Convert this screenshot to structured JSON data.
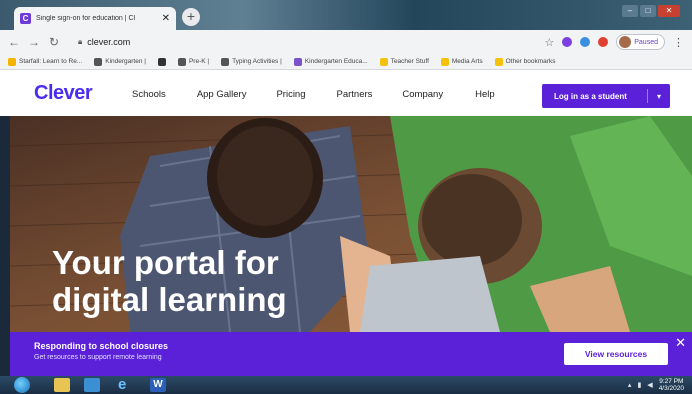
{
  "browser": {
    "tab_title": "Single sign-on for education | Cl",
    "tab_close": "✕",
    "new_tab": "+",
    "url": "clever.com",
    "profile_label": "Paused",
    "bookmarks": [
      {
        "label": "Starfall: Learn to Re...",
        "color": "#f4b400"
      },
      {
        "label": "Kindergarten |",
        "color": "#555555"
      },
      {
        "label": "",
        "color": "#333333"
      },
      {
        "label": "Pre-K |",
        "color": "#555555"
      },
      {
        "label": "Typing Activities |",
        "color": "#555555"
      },
      {
        "label": "Kindergarten Educa...",
        "color": "#7b52c9"
      },
      {
        "label": "Teacher Stuff",
        "color": "#f4c20d"
      },
      {
        "label": "Media Arts",
        "color": "#f4c20d"
      },
      {
        "label": "Other bookmarks",
        "color": "#f4c20d"
      }
    ]
  },
  "site": {
    "logo": "Clever",
    "nav": [
      "Schools",
      "App Gallery",
      "Pricing",
      "Partners",
      "Company",
      "Help"
    ],
    "login_label": "Log in as a student",
    "hero_line1": "Your portal for",
    "hero_line2": "digital learning",
    "banner_title": "Responding to school closures",
    "banner_subtitle": "Get resources to support remote learning",
    "banner_button": "View resources",
    "banner_close": "✕"
  },
  "taskbar": {
    "time": "9:27 PM",
    "date": "4/3/2020"
  },
  "colors": {
    "brand": "#4a2ef0",
    "brand_button": "#5b21d9"
  }
}
